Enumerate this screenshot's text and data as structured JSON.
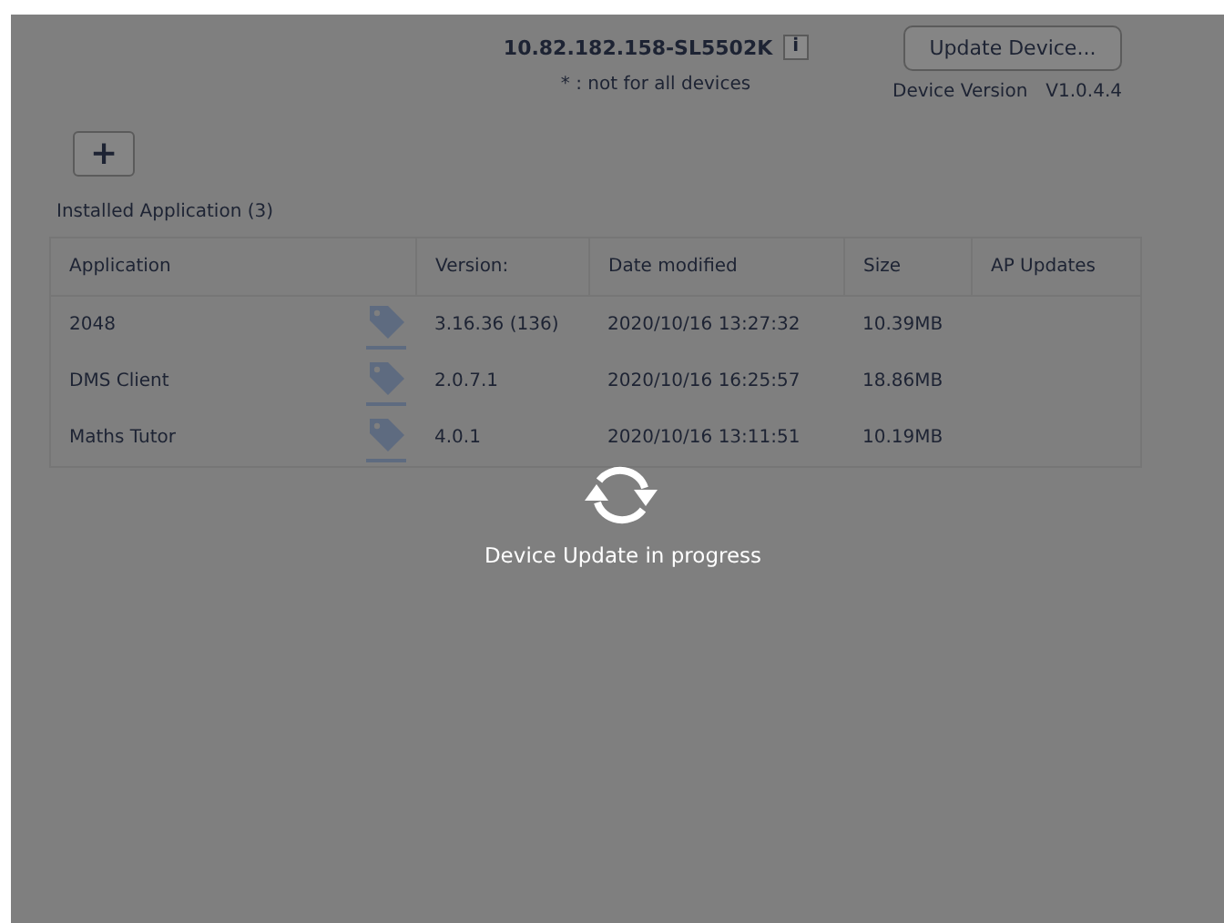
{
  "device": {
    "name": "10.82.182.158-SL5502K",
    "info_label": "i",
    "note": "* : not for all devices",
    "update_button": "Update Device...",
    "version_label": "Device Version",
    "version": "V1.0.4.4"
  },
  "add_button": {
    "label": "+"
  },
  "installed_title": "Installed Application (3)",
  "table": {
    "columns": [
      "Application",
      "Version:",
      "Date modified",
      "Size",
      "AP Updates"
    ],
    "rows": [
      {
        "application": "2048",
        "version": "3.16.36 (136)",
        "date_modified": "2020/10/16 13:27:32",
        "size": "10.39MB"
      },
      {
        "application": "DMS Client",
        "version": "2.0.7.1",
        "date_modified": "2020/10/16 16:25:57",
        "size": "18.86MB"
      },
      {
        "application": "Maths Tutor",
        "version": "4.0.1",
        "date_modified": "2020/10/16 13:11:51",
        "size": "10.19MB"
      }
    ]
  },
  "progress": {
    "message": "Device Update in progress"
  }
}
